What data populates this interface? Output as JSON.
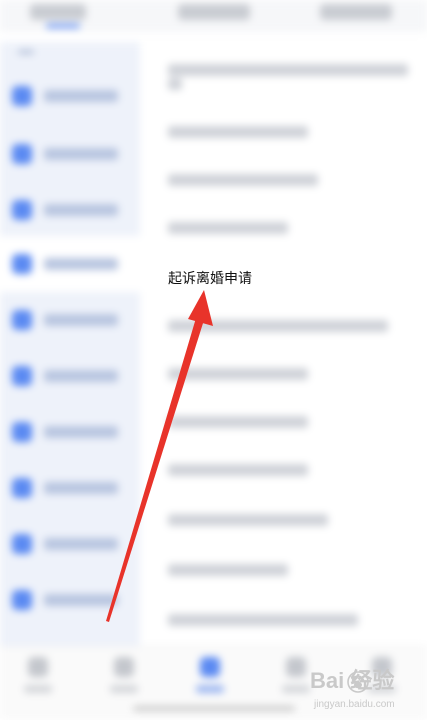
{
  "highlight": {
    "label": "起诉离婚申请"
  },
  "annotation": {
    "arrow_color": "#e8332a",
    "arrow_icon": "red-arrow-icon"
  },
  "watermark": {
    "brand": "Bai  经验",
    "paw_icon": "baidu-paw-icon",
    "url": "jingyan.baidu.com"
  },
  "colors": {
    "accent": "#5b8af2",
    "sidebar_bg": "#eef2fa"
  }
}
